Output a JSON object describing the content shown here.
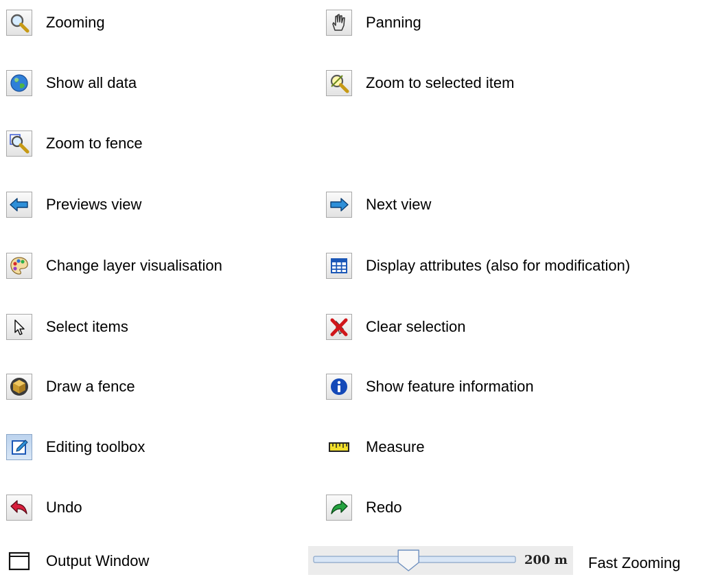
{
  "tools": {
    "zooming": "Zooming",
    "panning": "Panning",
    "show_all_data": "Show all data",
    "zoom_to_selected": "Zoom to selected item",
    "zoom_to_fence": "Zoom to fence",
    "previous_view": "Previews view",
    "next_view": "Next view",
    "change_layer_vis": "Change layer visualisation",
    "display_attributes": "Display attributes (also for modification)",
    "select_items": "Select items",
    "clear_selection": "Clear selection",
    "draw_fence": "Draw a fence",
    "show_feature_info": "Show feature information",
    "editing_toolbox": "Editing toolbox",
    "measure": "Measure",
    "undo": "Undo",
    "redo": "Redo",
    "output_window": "Output Window"
  },
  "fast_zoom": {
    "value_text": "200 m",
    "label": "Fast Zooming",
    "level": 0.47
  },
  "colors": {
    "arrow_blue": "#2e8fd8",
    "undo_red": "#d81e3c",
    "redo_green": "#23a33f",
    "info_blue": "#1449b8",
    "clear_red": "#d0161b",
    "ruler_yellow": "#f2df2b",
    "fence_box": "#c99a2e"
  }
}
